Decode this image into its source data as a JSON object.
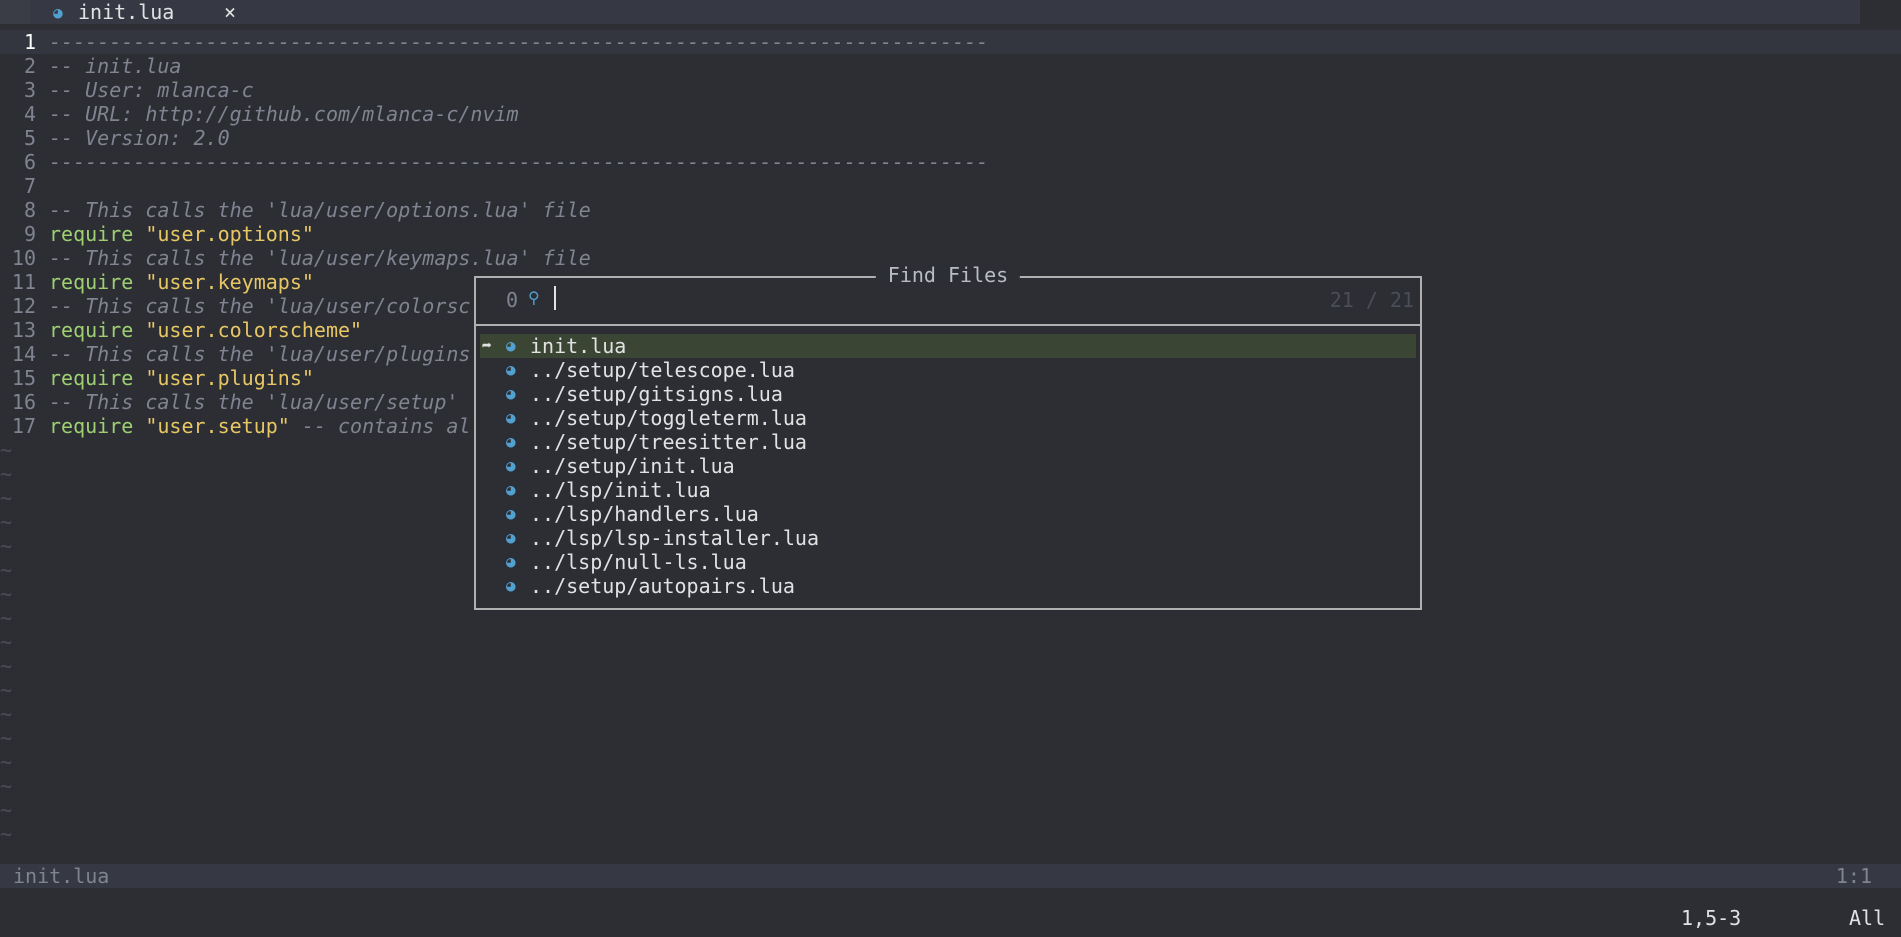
{
  "tabline": {
    "tab_icon": "lua-file-icon",
    "tab_label": "init.lua",
    "close_glyph": "×"
  },
  "editor": {
    "lines": [
      {
        "num": "1",
        "parts": [
          {
            "t": "------------------------------------------------------------------------------",
            "c": "comment"
          }
        ]
      },
      {
        "num": "2",
        "parts": [
          {
            "t": "-- init.lua",
            "c": "comment"
          }
        ]
      },
      {
        "num": "3",
        "parts": [
          {
            "t": "-- User: mlanca-c",
            "c": "comment"
          }
        ]
      },
      {
        "num": "4",
        "parts": [
          {
            "t": "-- URL: http://github.com/mlanca-c/nvim",
            "c": "comment"
          }
        ]
      },
      {
        "num": "5",
        "parts": [
          {
            "t": "-- Version: 2.0",
            "c": "comment"
          }
        ]
      },
      {
        "num": "6",
        "parts": [
          {
            "t": "------------------------------------------------------------------------------",
            "c": "comment"
          }
        ]
      },
      {
        "num": "7",
        "parts": []
      },
      {
        "num": "8",
        "parts": [
          {
            "t": "-- This calls the 'lua/user/options.lua' file",
            "c": "comment"
          }
        ]
      },
      {
        "num": "9",
        "parts": [
          {
            "t": "require ",
            "c": "kw"
          },
          {
            "t": "\"user.options\"",
            "c": "str"
          }
        ]
      },
      {
        "num": "10",
        "parts": [
          {
            "t": "-- This calls the 'lua/user/keymaps.lua' file",
            "c": "comment"
          }
        ]
      },
      {
        "num": "11",
        "parts": [
          {
            "t": "require ",
            "c": "kw"
          },
          {
            "t": "\"user.keymaps\"",
            "c": "str"
          }
        ]
      },
      {
        "num": "12",
        "parts": [
          {
            "t": "-- This calls the 'lua/user/colorsc",
            "c": "comment"
          }
        ]
      },
      {
        "num": "13",
        "parts": [
          {
            "t": "require ",
            "c": "kw"
          },
          {
            "t": "\"user.colorscheme\"",
            "c": "str"
          }
        ]
      },
      {
        "num": "14",
        "parts": [
          {
            "t": "-- This calls the 'lua/user/plugins",
            "c": "comment"
          }
        ]
      },
      {
        "num": "15",
        "parts": [
          {
            "t": "require ",
            "c": "kw"
          },
          {
            "t": "\"user.plugins\"",
            "c": "str"
          }
        ]
      },
      {
        "num": "16",
        "parts": [
          {
            "t": "-- This calls the 'lua/user/setup'",
            "c": "comment"
          }
        ]
      },
      {
        "num": "17",
        "parts": [
          {
            "t": "require ",
            "c": "kw"
          },
          {
            "t": "\"user.setup\"",
            "c": "str"
          },
          {
            "t": " -- contains al",
            "c": "comment"
          }
        ]
      }
    ],
    "empty_marker": "~",
    "empty_line_count": 17
  },
  "finder": {
    "title": "Find Files",
    "prompt_counter": "0",
    "prompt_icon": "telescope-icon",
    "prompt_value": "",
    "match_count": "21 / 21",
    "selection_caret": "➦",
    "results": [
      "init.lua",
      "../setup/telescope.lua",
      "../setup/gitsigns.lua",
      "../setup/toggleterm.lua",
      "../setup/treesitter.lua",
      "../setup/init.lua",
      "../lsp/init.lua",
      "../lsp/handlers.lua",
      "../lsp/lsp-installer.lua",
      "../lsp/null-ls.lua",
      "../setup/autopairs.lua"
    ],
    "selected_index": 0
  },
  "statusline": {
    "filename": "init.lua",
    "position": "1:1"
  },
  "cmdline": {
    "ruler": "1,5-3",
    "scroll": "All"
  },
  "colors": {
    "background": "#2c2e34",
    "comment": "#7f8490",
    "keyword": "#9ed072",
    "string": "#e7c664",
    "lua_icon": "#51a0cf",
    "selection": "#3b4534"
  }
}
